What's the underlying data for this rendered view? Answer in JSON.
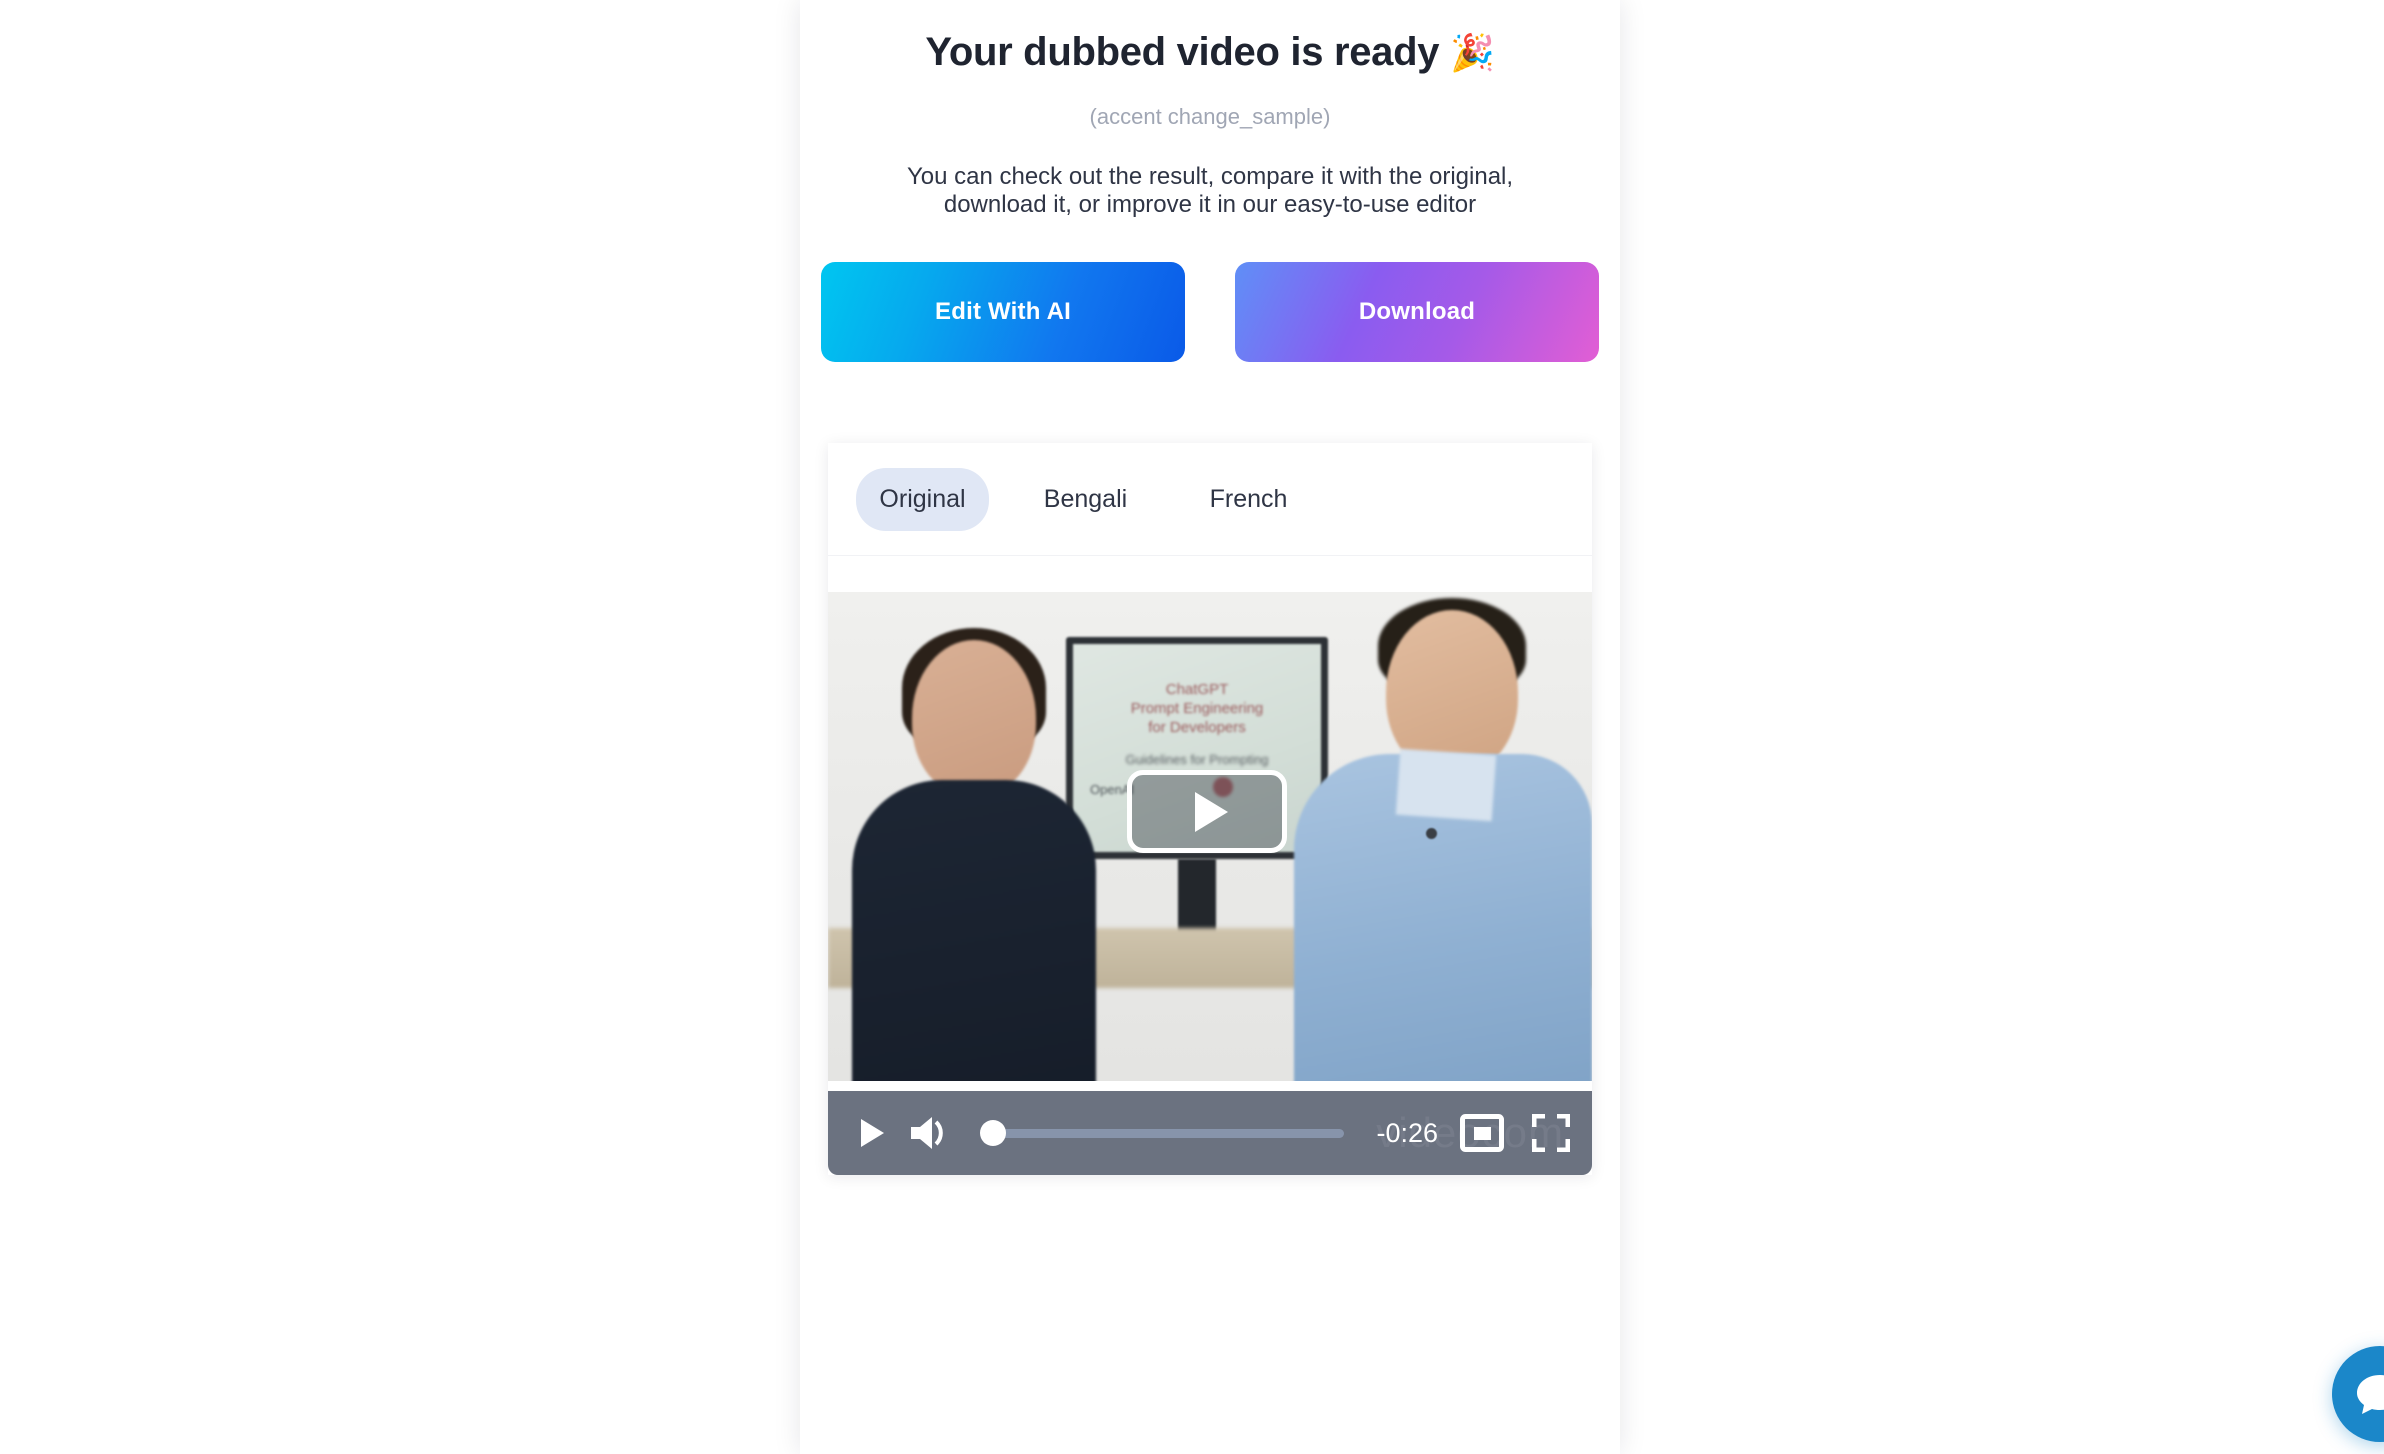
{
  "card": {
    "title": "Your dubbed video is ready",
    "title_emoji": "🎉",
    "subtitle": "(accent change_sample)",
    "description": "You can check out the result, compare it with the original, download it, or improve it in our easy-to-use editor"
  },
  "actions": {
    "edit_label": "Edit With AI",
    "download_label": "Download",
    "edit_gradient_from": "#00c6f0",
    "edit_gradient_to": "#0a5ae8",
    "download_gradient_from": "#5f8ff7",
    "download_gradient_to": "#e25ed4"
  },
  "tabs": {
    "items": [
      {
        "label": "Original",
        "active": true
      },
      {
        "label": "Bengali",
        "active": false
      },
      {
        "label": "French",
        "active": false
      }
    ],
    "active_background": "#e0e7f5"
  },
  "video": {
    "slide_title": "ChatGPT",
    "slide_line2": "Prompt Engineering",
    "slide_line3": "for Developers",
    "slide_subtitle": "Guidelines for Prompting",
    "slide_logo": "OpenAI",
    "play_overlay_icon": "play-triangle-icon"
  },
  "controls": {
    "play_icon": "play-icon",
    "volume_icon": "volume-high-icon",
    "time_remaining": "-0:26",
    "pip_icon": "picture-in-picture-icon",
    "fullscreen_icon": "fullscreen-icon",
    "progress_percent": 0,
    "bar_color": "#6b7280",
    "watermark": "videocom"
  },
  "chat": {
    "icon": "chat-bubble-icon",
    "color": "#1b87c9"
  }
}
